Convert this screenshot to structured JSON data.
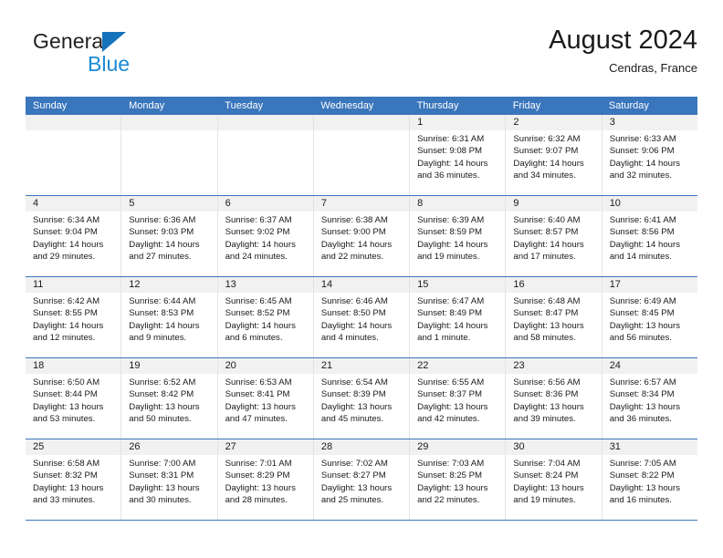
{
  "brand": {
    "line1": "General",
    "line2": "Blue",
    "triangle_color": "#1573bb"
  },
  "header": {
    "title": "August 2024",
    "subtitle": "Cendras, France"
  },
  "theme": {
    "header_blue": "#3a76bc",
    "daynum_band": "#f1f1f1",
    "cell_border": "#e3e3e3"
  },
  "calendar": {
    "weekday_headers": [
      "Sunday",
      "Monday",
      "Tuesday",
      "Wednesday",
      "Thursday",
      "Friday",
      "Saturday"
    ],
    "weeks": [
      [
        {
          "empty": true
        },
        {
          "empty": true
        },
        {
          "empty": true
        },
        {
          "empty": true
        },
        {
          "day": "1",
          "sunrise": "Sunrise: 6:31 AM",
          "sunset": "Sunset: 9:08 PM",
          "daylight": "Daylight: 14 hours and 36 minutes."
        },
        {
          "day": "2",
          "sunrise": "Sunrise: 6:32 AM",
          "sunset": "Sunset: 9:07 PM",
          "daylight": "Daylight: 14 hours and 34 minutes."
        },
        {
          "day": "3",
          "sunrise": "Sunrise: 6:33 AM",
          "sunset": "Sunset: 9:06 PM",
          "daylight": "Daylight: 14 hours and 32 minutes."
        }
      ],
      [
        {
          "day": "4",
          "sunrise": "Sunrise: 6:34 AM",
          "sunset": "Sunset: 9:04 PM",
          "daylight": "Daylight: 14 hours and 29 minutes."
        },
        {
          "day": "5",
          "sunrise": "Sunrise: 6:36 AM",
          "sunset": "Sunset: 9:03 PM",
          "daylight": "Daylight: 14 hours and 27 minutes."
        },
        {
          "day": "6",
          "sunrise": "Sunrise: 6:37 AM",
          "sunset": "Sunset: 9:02 PM",
          "daylight": "Daylight: 14 hours and 24 minutes."
        },
        {
          "day": "7",
          "sunrise": "Sunrise: 6:38 AM",
          "sunset": "Sunset: 9:00 PM",
          "daylight": "Daylight: 14 hours and 22 minutes."
        },
        {
          "day": "8",
          "sunrise": "Sunrise: 6:39 AM",
          "sunset": "Sunset: 8:59 PM",
          "daylight": "Daylight: 14 hours and 19 minutes."
        },
        {
          "day": "9",
          "sunrise": "Sunrise: 6:40 AM",
          "sunset": "Sunset: 8:57 PM",
          "daylight": "Daylight: 14 hours and 17 minutes."
        },
        {
          "day": "10",
          "sunrise": "Sunrise: 6:41 AM",
          "sunset": "Sunset: 8:56 PM",
          "daylight": "Daylight: 14 hours and 14 minutes."
        }
      ],
      [
        {
          "day": "11",
          "sunrise": "Sunrise: 6:42 AM",
          "sunset": "Sunset: 8:55 PM",
          "daylight": "Daylight: 14 hours and 12 minutes."
        },
        {
          "day": "12",
          "sunrise": "Sunrise: 6:44 AM",
          "sunset": "Sunset: 8:53 PM",
          "daylight": "Daylight: 14 hours and 9 minutes."
        },
        {
          "day": "13",
          "sunrise": "Sunrise: 6:45 AM",
          "sunset": "Sunset: 8:52 PM",
          "daylight": "Daylight: 14 hours and 6 minutes."
        },
        {
          "day": "14",
          "sunrise": "Sunrise: 6:46 AM",
          "sunset": "Sunset: 8:50 PM",
          "daylight": "Daylight: 14 hours and 4 minutes."
        },
        {
          "day": "15",
          "sunrise": "Sunrise: 6:47 AM",
          "sunset": "Sunset: 8:49 PM",
          "daylight": "Daylight: 14 hours and 1 minute."
        },
        {
          "day": "16",
          "sunrise": "Sunrise: 6:48 AM",
          "sunset": "Sunset: 8:47 PM",
          "daylight": "Daylight: 13 hours and 58 minutes."
        },
        {
          "day": "17",
          "sunrise": "Sunrise: 6:49 AM",
          "sunset": "Sunset: 8:45 PM",
          "daylight": "Daylight: 13 hours and 56 minutes."
        }
      ],
      [
        {
          "day": "18",
          "sunrise": "Sunrise: 6:50 AM",
          "sunset": "Sunset: 8:44 PM",
          "daylight": "Daylight: 13 hours and 53 minutes."
        },
        {
          "day": "19",
          "sunrise": "Sunrise: 6:52 AM",
          "sunset": "Sunset: 8:42 PM",
          "daylight": "Daylight: 13 hours and 50 minutes."
        },
        {
          "day": "20",
          "sunrise": "Sunrise: 6:53 AM",
          "sunset": "Sunset: 8:41 PM",
          "daylight": "Daylight: 13 hours and 47 minutes."
        },
        {
          "day": "21",
          "sunrise": "Sunrise: 6:54 AM",
          "sunset": "Sunset: 8:39 PM",
          "daylight": "Daylight: 13 hours and 45 minutes."
        },
        {
          "day": "22",
          "sunrise": "Sunrise: 6:55 AM",
          "sunset": "Sunset: 8:37 PM",
          "daylight": "Daylight: 13 hours and 42 minutes."
        },
        {
          "day": "23",
          "sunrise": "Sunrise: 6:56 AM",
          "sunset": "Sunset: 8:36 PM",
          "daylight": "Daylight: 13 hours and 39 minutes."
        },
        {
          "day": "24",
          "sunrise": "Sunrise: 6:57 AM",
          "sunset": "Sunset: 8:34 PM",
          "daylight": "Daylight: 13 hours and 36 minutes."
        }
      ],
      [
        {
          "day": "25",
          "sunrise": "Sunrise: 6:58 AM",
          "sunset": "Sunset: 8:32 PM",
          "daylight": "Daylight: 13 hours and 33 minutes."
        },
        {
          "day": "26",
          "sunrise": "Sunrise: 7:00 AM",
          "sunset": "Sunset: 8:31 PM",
          "daylight": "Daylight: 13 hours and 30 minutes."
        },
        {
          "day": "27",
          "sunrise": "Sunrise: 7:01 AM",
          "sunset": "Sunset: 8:29 PM",
          "daylight": "Daylight: 13 hours and 28 minutes."
        },
        {
          "day": "28",
          "sunrise": "Sunrise: 7:02 AM",
          "sunset": "Sunset: 8:27 PM",
          "daylight": "Daylight: 13 hours and 25 minutes."
        },
        {
          "day": "29",
          "sunrise": "Sunrise: 7:03 AM",
          "sunset": "Sunset: 8:25 PM",
          "daylight": "Daylight: 13 hours and 22 minutes."
        },
        {
          "day": "30",
          "sunrise": "Sunrise: 7:04 AM",
          "sunset": "Sunset: 8:24 PM",
          "daylight": "Daylight: 13 hours and 19 minutes."
        },
        {
          "day": "31",
          "sunrise": "Sunrise: 7:05 AM",
          "sunset": "Sunset: 8:22 PM",
          "daylight": "Daylight: 13 hours and 16 minutes."
        }
      ]
    ]
  }
}
